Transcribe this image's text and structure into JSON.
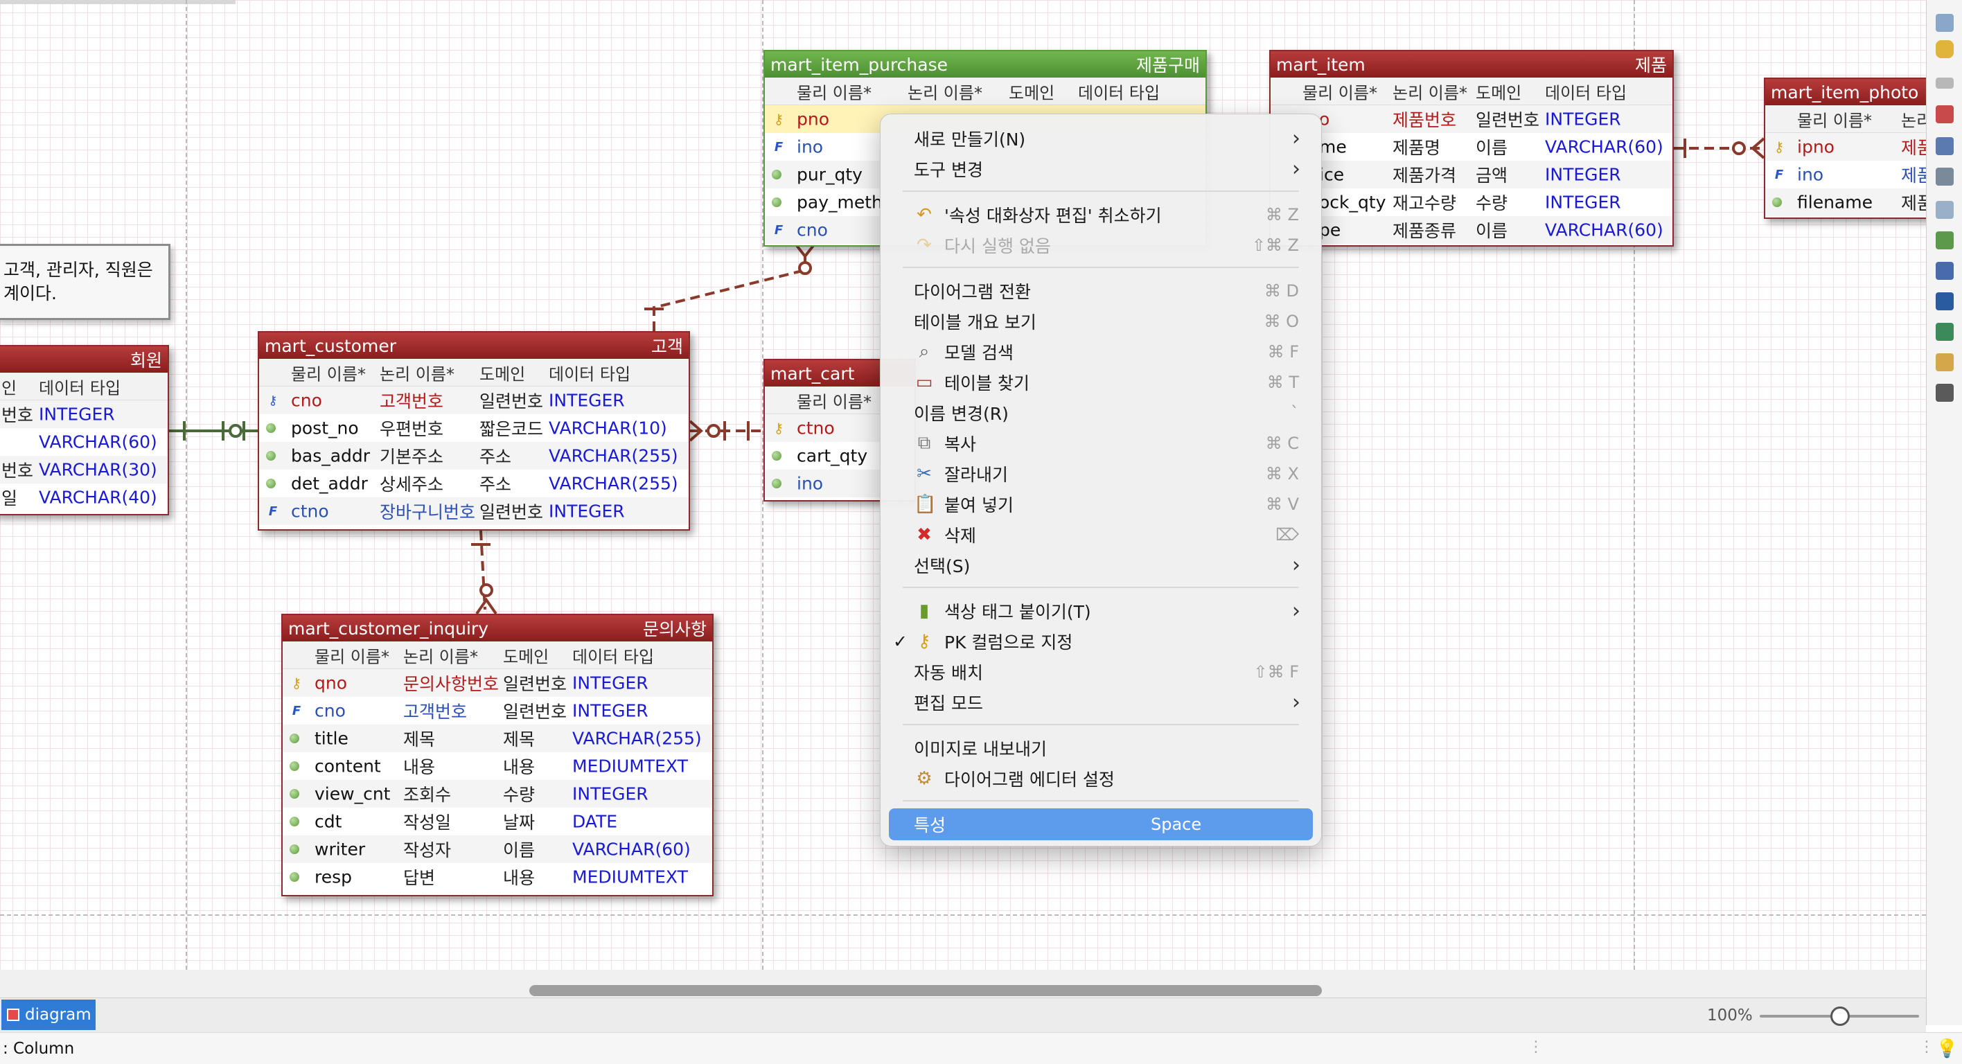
{
  "note": {
    "line1": "고객, 관리자, 직원은",
    "line2": "계이다."
  },
  "entities": {
    "member": {
      "name": "",
      "logical": "회원",
      "col_headers": {
        "logical": "인",
        "type": "데이터 타입"
      },
      "rows": [
        {
          "l": "번호",
          "t": "INTEGER"
        },
        {
          "l": "",
          "t": "VARCHAR(60)"
        },
        {
          "l": "번호",
          "t": "VARCHAR(30)"
        },
        {
          "l": "일",
          "t": "VARCHAR(40)"
        }
      ]
    },
    "customer": {
      "name": "mart_customer",
      "logical": "고객",
      "col_headers": {
        "physical": "물리 이름*",
        "logical": "논리 이름*",
        "domain": "도메인",
        "type": "데이터 타입"
      },
      "rows": [
        {
          "n": "cno",
          "l": "고객번호",
          "d": "일련번호",
          "t": "INTEGER"
        },
        {
          "n": "post_no",
          "l": "우편번호",
          "d": "짧은코드",
          "t": "VARCHAR(10)"
        },
        {
          "n": "bas_addr",
          "l": "기본주소",
          "d": "주소",
          "t": "VARCHAR(255)"
        },
        {
          "n": "det_addr",
          "l": "상세주소",
          "d": "주소",
          "t": "VARCHAR(255)"
        },
        {
          "n": "ctno",
          "l": "장바구니번호",
          "d": "일련번호",
          "t": "INTEGER"
        }
      ]
    },
    "inquiry": {
      "name": "mart_customer_inquiry",
      "logical": "문의사항",
      "col_headers": {
        "physical": "물리 이름*",
        "logical": "논리 이름*",
        "domain": "도메인",
        "type": "데이터 타입"
      },
      "rows": [
        {
          "n": "qno",
          "l": "문의사항번호",
          "d": "일련번호",
          "t": "INTEGER"
        },
        {
          "n": "cno",
          "l": "고객번호",
          "d": "일련번호",
          "t": "INTEGER"
        },
        {
          "n": "title",
          "l": "제목",
          "d": "제목",
          "t": "VARCHAR(255)"
        },
        {
          "n": "content",
          "l": "내용",
          "d": "내용",
          "t": "MEDIUMTEXT"
        },
        {
          "n": "view_cnt",
          "l": "조회수",
          "d": "수량",
          "t": "INTEGER"
        },
        {
          "n": "cdt",
          "l": "작성일",
          "d": "날짜",
          "t": "DATE"
        },
        {
          "n": "writer",
          "l": "작성자",
          "d": "이름",
          "t": "VARCHAR(60)"
        },
        {
          "n": "resp",
          "l": "답변",
          "d": "내용",
          "t": "MEDIUMTEXT"
        }
      ]
    },
    "purchase": {
      "name": "mart_item_purchase",
      "logical": "제품구매",
      "col_headers": {
        "physical": "물리 이름*",
        "logical": "논리 이름*",
        "domain": "도메인",
        "type": "데이터 타입"
      },
      "rows": [
        {
          "n": "pno"
        },
        {
          "n": "ino"
        },
        {
          "n": "pur_qty"
        },
        {
          "n": "pay_meth"
        },
        {
          "n": "cno"
        }
      ]
    },
    "cart": {
      "name": "mart_cart",
      "logical": "",
      "col_headers": {
        "physical": "물리 이름*"
      },
      "rows": [
        {
          "n": "ctno"
        },
        {
          "n": "cart_qty"
        },
        {
          "n": "ino"
        }
      ]
    },
    "item": {
      "name": "mart_item",
      "logical": "제품",
      "col_headers": {
        "physical": "물리 이름*",
        "logical": "논리 이름*",
        "domain": "도메인",
        "type": "데이터 타입"
      },
      "rows": [
        {
          "n": "o",
          "l": "제품번호",
          "d": "일련번호",
          "t": "INTEGER"
        },
        {
          "n": "me",
          "l": "제품명",
          "d": "이름",
          "t": "VARCHAR(60)"
        },
        {
          "n": "ice",
          "l": "제품가격",
          "d": "금액",
          "t": "INTEGER"
        },
        {
          "n": "ock_qty",
          "l": "재고수량",
          "d": "수량",
          "t": "INTEGER"
        },
        {
          "n": "pe",
          "l": "제품종류",
          "d": "이름",
          "t": "VARCHAR(60)"
        }
      ]
    },
    "photo": {
      "name": "mart_item_photo",
      "logical": "",
      "col_headers": {
        "physical": "물리 이름*",
        "logical": "논리"
      },
      "rows": [
        {
          "n": "ipno",
          "l": "제품"
        },
        {
          "n": "ino",
          "l": "제품"
        },
        {
          "n": "filename",
          "l": "제품"
        }
      ]
    }
  },
  "context_menu": {
    "items": [
      {
        "label": "새로 만들기(N)",
        "submenu": true
      },
      {
        "label": "도구 변경",
        "submenu": true
      },
      {
        "label": "'속성 대화상자 편집' 취소하기",
        "shortcut": "⌘ Z",
        "icon": "undo-icon"
      },
      {
        "label": "다시 실행 없음",
        "shortcut": "⇧⌘ Z",
        "icon": "redo-icon",
        "disabled": true
      },
      {
        "label": "다이어그램 전환",
        "shortcut": "⌘ D"
      },
      {
        "label": "테이블 개요 보기",
        "shortcut": "⌘ O"
      },
      {
        "label": "모델 검색",
        "shortcut": "⌘ F",
        "icon": "search-icon"
      },
      {
        "label": "테이블 찾기",
        "shortcut": "⌘ T",
        "icon": "table-icon"
      },
      {
        "label": "이름 변경(R)",
        "shortcut": "`"
      },
      {
        "label": "복사",
        "shortcut": "⌘ C",
        "icon": "copy-icon"
      },
      {
        "label": "잘라내기",
        "shortcut": "⌘ X",
        "icon": "scissors-icon"
      },
      {
        "label": "붙여 넣기",
        "shortcut": "⌘ V",
        "icon": "paste-icon"
      },
      {
        "label": "삭제",
        "shortcut": "⌦",
        "icon": "delete-icon"
      },
      {
        "label": "선택(S)",
        "submenu": true
      },
      {
        "label": "색상 태그 붙이기(T)",
        "submenu": true,
        "icon": "color-tag-icon"
      },
      {
        "label": "PK 컬럼으로 지정",
        "checked": true,
        "icon": "key-icon"
      },
      {
        "label": "자동 배치",
        "shortcut": "⇧⌘ F"
      },
      {
        "label": "편집 모드",
        "submenu": true
      },
      {
        "label": "이미지로 내보내기"
      },
      {
        "label": "다이어그램 에디터 설정",
        "icon": "gear-icon"
      },
      {
        "label": "특성",
        "shortcut": "Space",
        "highlighted": true
      }
    ]
  },
  "tabs": {
    "diagram": "diagram"
  },
  "zoom": {
    "label": "100%",
    "value": 100
  },
  "status": {
    "text": ": Column"
  },
  "colors": {
    "entity_header": "#8b1d1d",
    "entity_header_selected": "#4b8f33",
    "menu_highlight": "#5d9cec",
    "type_text": "#1a1ad6"
  }
}
